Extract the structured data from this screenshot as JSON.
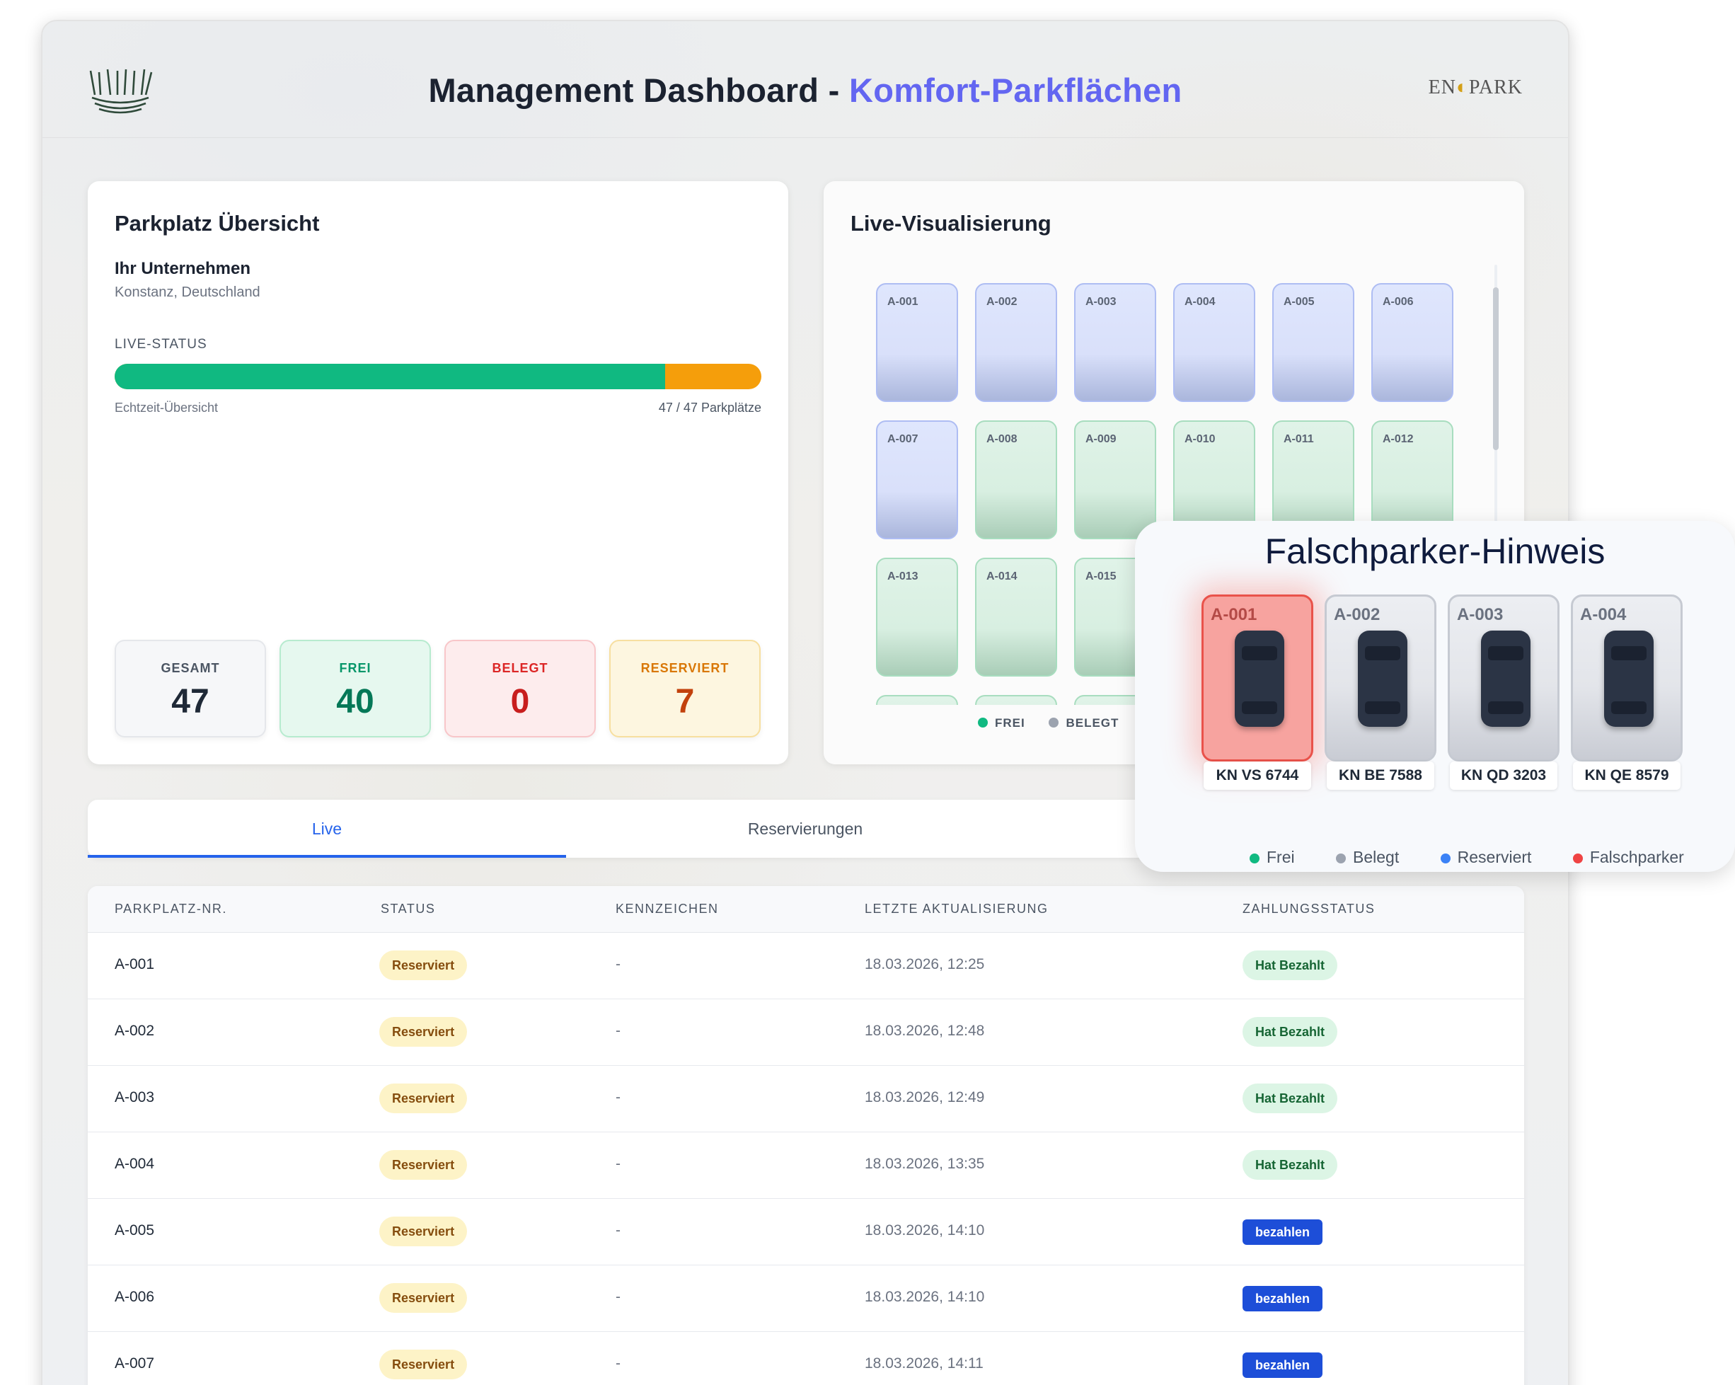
{
  "header": {
    "title_main": "Management Dashboard - ",
    "title_accent": "Komfort-Parkflächen",
    "logo_left": "MAINAU",
    "logo_right_a": "EN",
    "logo_right_b": "PARK"
  },
  "overview": {
    "title": "Parkplatz Übersicht",
    "company": "Ihr Unternehmen",
    "location": "Konstanz, Deutschland",
    "live_label": "LIVE-STATUS",
    "bar_note": "Echtzeit-Übersicht",
    "bar_count": "47 / 47 Parkplätze",
    "bar_free_fraction": 0.851,
    "stats": {
      "gesamt_label": "GESAMT",
      "gesamt": "47",
      "frei_label": "FREI",
      "frei": "40",
      "belegt_label": "BELEGT",
      "belegt": "0",
      "res_label": "RESERVIERT",
      "res": "7"
    }
  },
  "live": {
    "title": "Live-Visualisierung",
    "spots": [
      {
        "id": "A-001",
        "state": "res"
      },
      {
        "id": "A-002",
        "state": "res"
      },
      {
        "id": "A-003",
        "state": "res"
      },
      {
        "id": "A-004",
        "state": "res"
      },
      {
        "id": "A-005",
        "state": "res"
      },
      {
        "id": "A-006",
        "state": "res"
      },
      {
        "id": "A-007",
        "state": "res"
      },
      {
        "id": "A-008",
        "state": "free"
      },
      {
        "id": "A-009",
        "state": "free"
      },
      {
        "id": "A-010",
        "state": "free"
      },
      {
        "id": "A-011",
        "state": "free"
      },
      {
        "id": "A-012",
        "state": "free"
      },
      {
        "id": "A-013",
        "state": "free"
      },
      {
        "id": "A-014",
        "state": "free"
      },
      {
        "id": "A-015",
        "state": "free"
      },
      {
        "id": "",
        "state": "free"
      },
      {
        "id": "",
        "state": "free"
      },
      {
        "id": "",
        "state": "free"
      },
      {
        "id": "",
        "state": "free"
      },
      {
        "id": "",
        "state": "free"
      },
      {
        "id": "",
        "state": "free"
      }
    ],
    "legend_frei": "FREI",
    "legend_belegt": "BELEGT"
  },
  "tabs": {
    "live": "Live",
    "reservierungen": "Reservierungen"
  },
  "table": {
    "headers": {
      "nr": "PARKPLATZ-NR.",
      "status": "STATUS",
      "kennzeichen": "KENNZEICHEN",
      "update": "LETZTE AKTUALISIERUNG",
      "payment": "ZAHLUNGSSTATUS"
    },
    "rows": [
      {
        "nr": "A-001",
        "status": "Reserviert",
        "kennzeichen": "-",
        "update": "18.03.2026, 12:25",
        "payment": "Hat Bezahlt",
        "paid": true
      },
      {
        "nr": "A-002",
        "status": "Reserviert",
        "kennzeichen": "-",
        "update": "18.03.2026, 12:48",
        "payment": "Hat Bezahlt",
        "paid": true
      },
      {
        "nr": "A-003",
        "status": "Reserviert",
        "kennzeichen": "-",
        "update": "18.03.2026, 12:49",
        "payment": "Hat Bezahlt",
        "paid": true
      },
      {
        "nr": "A-004",
        "status": "Reserviert",
        "kennzeichen": "-",
        "update": "18.03.2026, 13:35",
        "payment": "Hat Bezahlt",
        "paid": true
      },
      {
        "nr": "A-005",
        "status": "Reserviert",
        "kennzeichen": "-",
        "update": "18.03.2026, 14:10",
        "payment": "bezahlen",
        "paid": false
      },
      {
        "nr": "A-006",
        "status": "Reserviert",
        "kennzeichen": "-",
        "update": "18.03.2026, 14:10",
        "payment": "bezahlen",
        "paid": false
      },
      {
        "nr": "A-007",
        "status": "Reserviert",
        "kennzeichen": "-",
        "update": "18.03.2026, 14:11",
        "payment": "bezahlen",
        "paid": false
      }
    ]
  },
  "overlay": {
    "title": "Falschparker-Hinweis",
    "spots": [
      {
        "id": "A-001",
        "plate": "KN VS 6744",
        "alert": true
      },
      {
        "id": "A-002",
        "plate": "KN BE 7588",
        "alert": false
      },
      {
        "id": "A-003",
        "plate": "KN QD 3203",
        "alert": false
      },
      {
        "id": "A-004",
        "plate": "KN QE 8579",
        "alert": false
      }
    ],
    "legend": {
      "frei": "Frei",
      "belegt": "Belegt",
      "reserviert": "Reserviert",
      "falschparker": "Falschparker"
    }
  },
  "colors": {
    "accent": "#6366f1",
    "frei": "#10b981",
    "belegt": "#9ca3af",
    "reserviert": "#f59e0b",
    "falschparker": "#ef4444",
    "primary": "#2563eb"
  }
}
